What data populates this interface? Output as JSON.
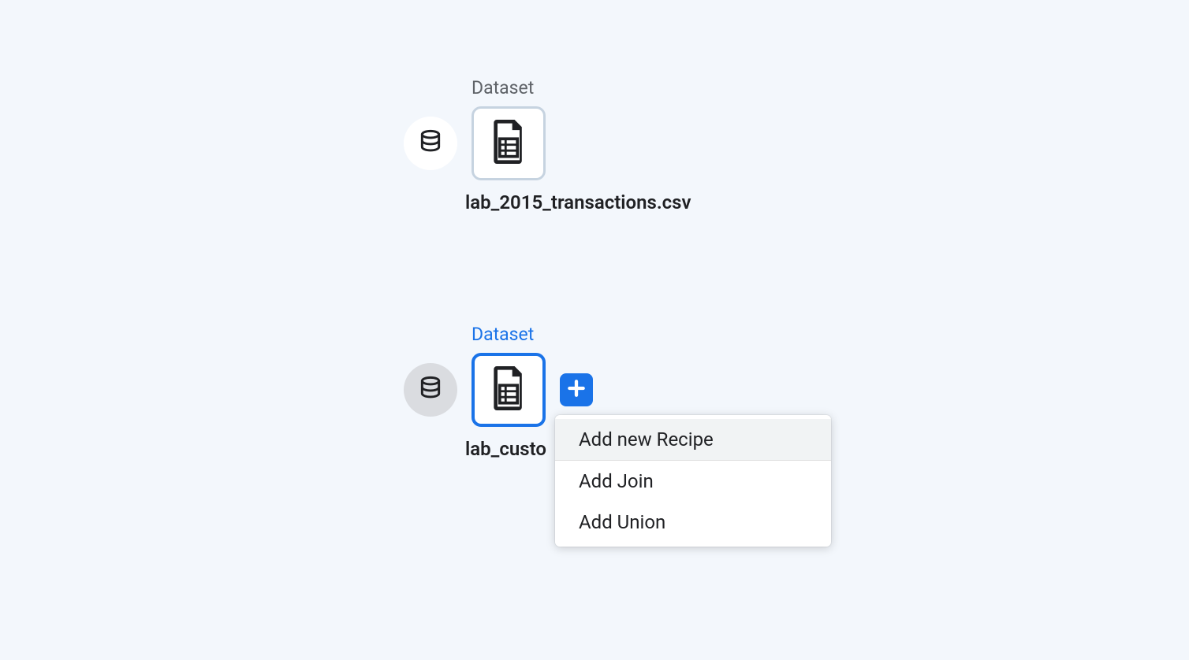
{
  "nodes": {
    "0": {
      "type_label": "Dataset",
      "filename": "lab_2015_transactions.csv"
    },
    "1": {
      "type_label": "Dataset",
      "filename": "lab_custo"
    }
  },
  "menu": {
    "items": {
      "0": "Add new Recipe",
      "1": "Add Join",
      "2": "Add Union"
    }
  }
}
